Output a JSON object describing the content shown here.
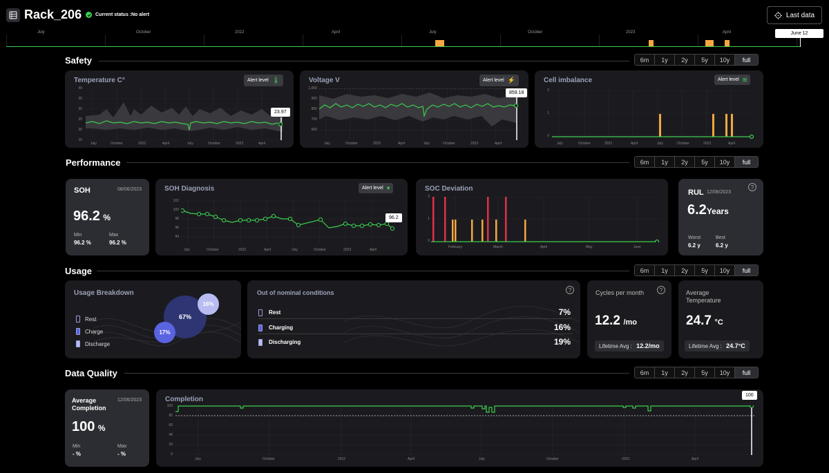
{
  "header": {
    "title": "Rack_206",
    "status_label": "Current status :",
    "status_value": "No alert",
    "last_data_label": "Last data"
  },
  "timeline": {
    "months": [
      "July",
      "October",
      "2022",
      "April",
      "July",
      "October",
      "2023",
      "April"
    ],
    "current_label": "June 12"
  },
  "range_options": [
    "6m",
    "1y",
    "2y",
    "5y",
    "10y",
    "full"
  ],
  "range_selected": "full",
  "sections": {
    "safety": "Safety",
    "performance": "Performance",
    "usage": "Usage",
    "data_quality": "Data Quality"
  },
  "alert_level_label": "Alert level",
  "safety": {
    "temperature": {
      "title": "Temperature C°",
      "tooltip": "23.97",
      "y_ticks": [
        "40",
        "35",
        "30",
        "25",
        "20",
        "15"
      ],
      "x_ticks": [
        "July",
        "October",
        "2022",
        "April",
        "July",
        "October",
        "2023",
        "April"
      ]
    },
    "voltage": {
      "title": "Voltage V",
      "tooltip": "859.18",
      "y_ticks": [
        "1,000",
        "900",
        "800",
        "700",
        "600"
      ],
      "x_ticks": [
        "July",
        "October",
        "2022",
        "April",
        "July",
        "October",
        "2023",
        "April"
      ]
    },
    "cell_imbalance": {
      "title": "Cell imbalance",
      "y_ticks": [
        "2",
        "1",
        "0"
      ],
      "x_ticks": [
        "July",
        "October",
        "2022",
        "April",
        "July",
        "October",
        "2023",
        "April"
      ]
    }
  },
  "performance": {
    "soh": {
      "title": "SOH",
      "date": "08/06/2023",
      "value": "96.2",
      "unit": "%",
      "min_label": "Min",
      "min_value": "96.2 %",
      "max_label": "Max",
      "max_value": "96.2 %"
    },
    "soh_diagnosis": {
      "title": "SOH Diagnosis",
      "tooltip": "96.2",
      "y_ticks": [
        "102",
        "100",
        "98",
        "96",
        "94"
      ],
      "x_ticks": [
        "July",
        "October",
        "2022",
        "April",
        "July",
        "October",
        "2023",
        "April"
      ]
    },
    "soc_deviation": {
      "title": "SOC Deviation",
      "y_ticks": [
        "2",
        "1",
        "0"
      ],
      "x_ticks": [
        "February",
        "March",
        "April",
        "May",
        "June"
      ]
    },
    "rul": {
      "title": "RUL",
      "date": "12/06/2023",
      "value": "6.2",
      "unit": "Years",
      "worst_label": "Worst",
      "worst_value": "6.2 y",
      "best_label": "Best",
      "best_value": "6.2 y"
    }
  },
  "usage": {
    "breakdown": {
      "title": "Usage Breakdown",
      "legend": [
        "Rest",
        "Charge",
        "Discharge"
      ],
      "rest_pct": "67%",
      "charge_pct": "17%",
      "discharge_pct": "16%"
    },
    "nominal": {
      "title": "Out of nominal conditions",
      "rows": [
        {
          "label": "Rest",
          "value": "7%"
        },
        {
          "label": "Charging",
          "value": "16%"
        },
        {
          "label": "Discharging",
          "value": "19%"
        }
      ]
    },
    "cycles": {
      "title": "Cycles per month",
      "value": "12.2",
      "unit": "/mo",
      "avg_label": "Lifetime Avg :",
      "avg_value": "12.2/mo"
    },
    "avg_temp": {
      "title": "Average Temperature",
      "value": "24.7",
      "unit": "°C",
      "avg_label": "Lifetime Avg :",
      "avg_value": "24.7°C"
    }
  },
  "data_quality": {
    "avg_completion": {
      "title": "Average Completion",
      "date": "12/06/2023",
      "value": "100",
      "unit": "%",
      "min_label": "Min",
      "min_value": "- %",
      "max_label": "Max",
      "max_value": "- %"
    },
    "completion": {
      "title": "Completion",
      "tooltip": "100",
      "y_ticks": [
        "100",
        "80",
        "60",
        "40",
        "20",
        "0"
      ],
      "x_ticks": [
        "July",
        "October",
        "2022",
        "April",
        "July",
        "October",
        "2023",
        "April"
      ]
    }
  },
  "colors": {
    "accent_green": "#3ccf4e",
    "bar_orange": "#f5a742",
    "bar_red": "#e0304a",
    "card_bg": "#1b1b1f",
    "card_light_bg": "#2c2d32",
    "bubble_rest": "#2e3572",
    "bubble_charge": "#5a63e0",
    "bubble_discharge": "#b8bcf2"
  }
}
